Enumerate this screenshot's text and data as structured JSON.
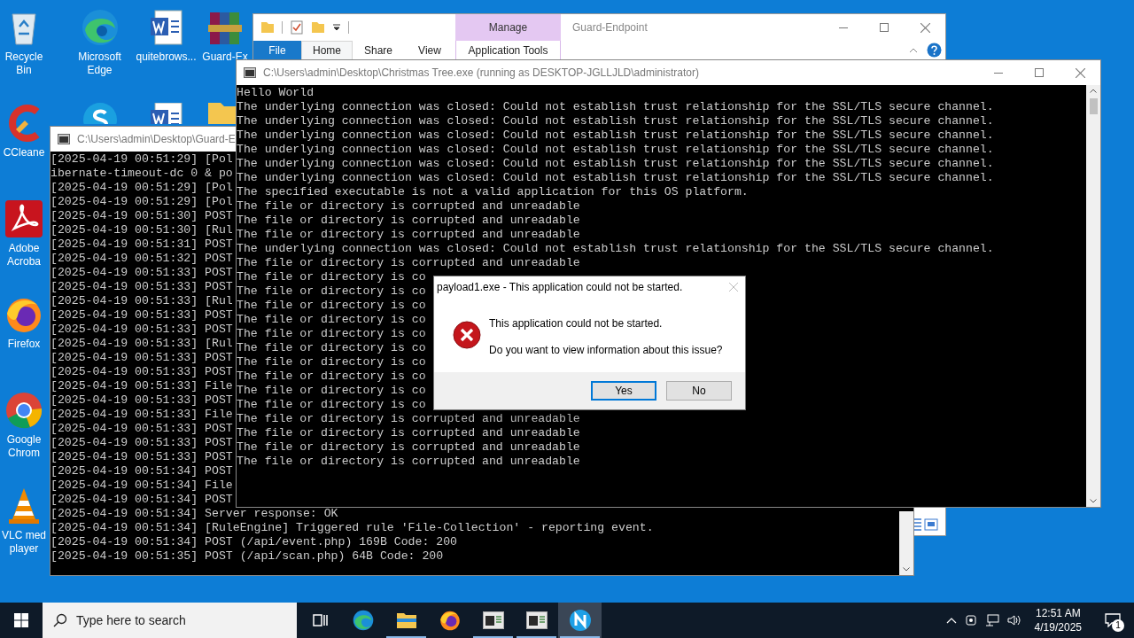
{
  "desktop": {
    "columns": [
      [
        {
          "kind": "recycle",
          "label": "Recycle Bin"
        },
        {
          "kind": "ccleaner",
          "label": "CCleane"
        },
        {
          "kind": "acrobat",
          "label": "Adobe Acroba"
        },
        {
          "kind": "firefox",
          "label": "Firefox"
        },
        {
          "kind": "chrome",
          "label": "Google Chrom"
        },
        {
          "kind": "vlc",
          "label": "VLC med player"
        }
      ],
      [
        {
          "kind": "edge",
          "label": "Microsoft Edge"
        },
        {
          "kind": "skype"
        }
      ],
      [
        {
          "kind": "word",
          "label": "quitebrows..."
        },
        {
          "kind": "word"
        }
      ],
      [
        {
          "kind": "winrar",
          "label": "Guard-Ex"
        },
        {
          "kind": "folder"
        }
      ]
    ]
  },
  "explorer": {
    "title": "Guard-Endpoint",
    "context_group": "Manage",
    "tabs": [
      {
        "label": "File",
        "kind": "file",
        "selected": false
      },
      {
        "label": "Home",
        "kind": "tab",
        "selected": true
      },
      {
        "label": "Share",
        "kind": "tab",
        "selected": false
      },
      {
        "label": "View",
        "kind": "tab",
        "selected": false
      },
      {
        "label": "Application Tools",
        "kind": "context",
        "selected": false
      }
    ]
  },
  "guard_console": {
    "title": "C:\\Users\\admin\\Desktop\\Guard-E",
    "lines": [
      "[2025-04-19 00:51:29] [Pol",
      "ibernate-timeout-dc 0 & po",
      "[2025-04-19 00:51:29] [Pol",
      "[2025-04-19 00:51:29] [Pol",
      "[2025-04-19 00:51:30] POST",
      "[2025-04-19 00:51:30] [Rul",
      "[2025-04-19 00:51:31] POST",
      "[2025-04-19 00:51:32] POST",
      "[2025-04-19 00:51:33] POST",
      "[2025-04-19 00:51:33] POST",
      "[2025-04-19 00:51:33] [Rul",
      "[2025-04-19 00:51:33] POST",
      "[2025-04-19 00:51:33] POST",
      "[2025-04-19 00:51:33] [Rul",
      "[2025-04-19 00:51:33] POST",
      "[2025-04-19 00:51:33] POST",
      "[2025-04-19 00:51:33] File",
      "[2025-04-19 00:51:33] POST",
      "[2025-04-19 00:51:33] File",
      "[2025-04-19 00:51:33] POST",
      "[2025-04-19 00:51:33] POST",
      "[2025-04-19 00:51:33] POST",
      "[2025-04-19 00:51:34] POST",
      "[2025-04-19 00:51:34] File",
      "[2025-04-19 00:51:34] POST",
      "[2025-04-19 00:51:34] Server response: OK",
      "[2025-04-19 00:51:34] [RuleEngine] Triggered rule 'File-Collection' - reporting event.",
      "[2025-04-19 00:51:34] POST (/api/event.php) 169B Code: 200",
      "[2025-04-19 00:51:35] POST (/api/scan.php) 64B Code: 200"
    ]
  },
  "tree_console": {
    "title": "C:\\Users\\admin\\Desktop\\Christmas Tree.exe (running as DESKTOP-JGLLJLD\\administrator)",
    "lines": [
      "Hello World",
      "The underlying connection was closed: Could not establish trust relationship for the SSL/TLS secure channel.",
      "The underlying connection was closed: Could not establish trust relationship for the SSL/TLS secure channel.",
      "The underlying connection was closed: Could not establish trust relationship for the SSL/TLS secure channel.",
      "The underlying connection was closed: Could not establish trust relationship for the SSL/TLS secure channel.",
      "The underlying connection was closed: Could not establish trust relationship for the SSL/TLS secure channel.",
      "The underlying connection was closed: Could not establish trust relationship for the SSL/TLS secure channel.",
      "The specified executable is not a valid application for this OS platform.",
      "The file or directory is corrupted and unreadable",
      "The file or directory is corrupted and unreadable",
      "The file or directory is corrupted and unreadable",
      "The underlying connection was closed: Could not establish trust relationship for the SSL/TLS secure channel.",
      "The file or directory is corrupted and unreadable",
      "The file or directory is co",
      "The file or directory is co",
      "The file or directory is co",
      "The file or directory is co",
      "The file or directory is co",
      "The file or directory is co",
      "The file or directory is co",
      "The file or directory is co",
      "The file or directory is co",
      "The file or directory is co",
      "The file or directory is corrupted and unreadable",
      "The file or directory is corrupted and unreadable",
      "The file or directory is corrupted and unreadable",
      "The file or directory is corrupted and unreadable"
    ]
  },
  "dialog": {
    "title": "payload1.exe - This application could not be started.",
    "message": "This application could not be started.",
    "question": "Do you want to view information about this issue?",
    "buttons": [
      {
        "label": "Yes",
        "selected": true
      },
      {
        "label": "No",
        "selected": false
      }
    ]
  },
  "taskbar": {
    "search_placeholder": "Type here to search",
    "apps": [
      {
        "kind": "taskview",
        "running": false,
        "selected": false
      },
      {
        "kind": "edge",
        "running": false,
        "selected": false
      },
      {
        "kind": "explorer",
        "running": true,
        "selected": false
      },
      {
        "kind": "firefox",
        "running": false,
        "selected": false
      },
      {
        "kind": "console",
        "running": true,
        "selected": false
      },
      {
        "kind": "console",
        "running": true,
        "selected": false
      },
      {
        "kind": "napp",
        "running": true,
        "selected": true
      }
    ],
    "time": "12:51 AM",
    "date": "4/19/2025",
    "notifications": "1"
  }
}
